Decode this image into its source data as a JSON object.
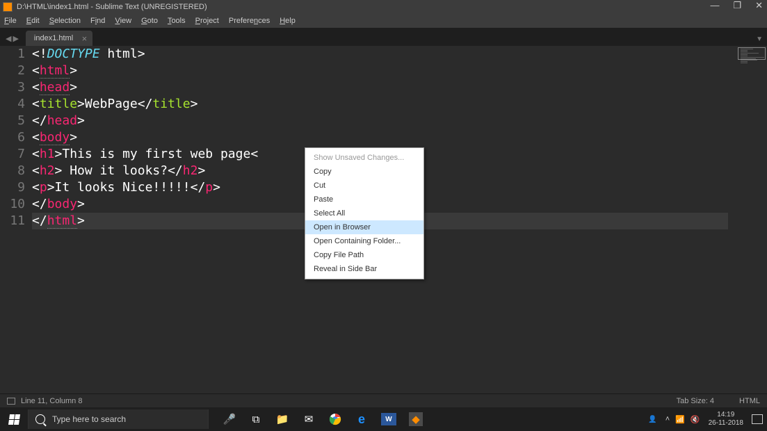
{
  "titlebar": {
    "title": "D:\\HTML\\index1.html - Sublime Text (UNREGISTERED)"
  },
  "menubar": {
    "file": "File",
    "edit": "Edit",
    "selection": "Selection",
    "find": "Find",
    "view": "View",
    "goto": "Goto",
    "tools": "Tools",
    "project": "Project",
    "preferences": "Preferences",
    "help": "Help"
  },
  "tabs": {
    "tab1": "index1.html"
  },
  "gutter": [
    "1",
    "2",
    "3",
    "4",
    "5",
    "6",
    "7",
    "8",
    "9",
    "10",
    "11"
  ],
  "code": {
    "l1": {
      "a": "<!",
      "b": "DOCTYPE",
      "c": " html",
      "d": ">"
    },
    "l2": {
      "a": "<",
      "b": "html",
      "c": ">"
    },
    "l3": {
      "a": "<",
      "b": "head",
      "c": ">"
    },
    "l4": {
      "a": "<",
      "b": "title",
      "c": ">",
      "d": "WebPage",
      "e": "</",
      "f": "title",
      "g": ">"
    },
    "l5": {
      "a": "</",
      "b": "head",
      "c": ">"
    },
    "l6": {
      "a": "<",
      "b": "body",
      "c": ">"
    },
    "l7": {
      "a": "<",
      "b": "h1",
      "c": ">",
      "d": "This is my first web page",
      "e": "<"
    },
    "l8": {
      "a": "<",
      "b": "h2",
      "c": ">",
      "d": " How it looks?",
      "e": "</",
      "f": "h2",
      "g": ">"
    },
    "l9": {
      "a": "<",
      "b": "p",
      "c": ">",
      "d": "It looks Nice!!!!!",
      "e": "</",
      "f": "p",
      "g": ">"
    },
    "l10": {
      "a": "</",
      "b": "body",
      "c": ">"
    },
    "l11": {
      "a": "</",
      "b": "html",
      "c": ">"
    }
  },
  "context_menu": {
    "show_unsaved": "Show Unsaved Changes...",
    "copy": "Copy",
    "cut": "Cut",
    "paste": "Paste",
    "select_all": "Select All",
    "open_browser": "Open in Browser",
    "open_folder": "Open Containing Folder...",
    "copy_path": "Copy File Path",
    "reveal_sidebar": "Reveal in Side Bar"
  },
  "statusbar": {
    "position": "Line 11, Column 8",
    "tabsize": "Tab Size: 4",
    "syntax": "HTML"
  },
  "taskbar": {
    "search_placeholder": "Type here to search",
    "time": "14:19",
    "date": "26-11-2018"
  }
}
